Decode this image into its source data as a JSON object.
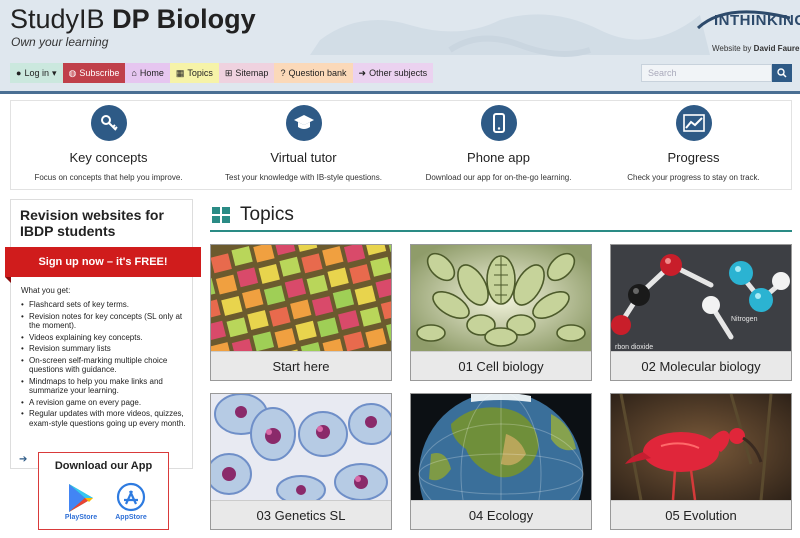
{
  "header": {
    "title_light": "StudyIB",
    "title_bold": "DP Biology",
    "tagline": "Own your learning",
    "logo_text": "INTHINKING",
    "byline_prefix": "Website by",
    "byline_author": "David Faure"
  },
  "nav": {
    "items": [
      {
        "label": "Log in",
        "icon": "user-icon",
        "color": "#cbe8de"
      },
      {
        "label": "Subscribe",
        "icon": "globe-icon",
        "color": "#c0404a"
      },
      {
        "label": "Home",
        "icon": "home-icon",
        "color": "#e6c6f0"
      },
      {
        "label": "Topics",
        "icon": "grid-icon",
        "color": "#f6f3a8"
      },
      {
        "label": "Sitemap",
        "icon": "sitemap-icon",
        "color": "#efd2df"
      },
      {
        "label": "Question bank",
        "icon": "question-icon",
        "color": "#fbd9b9"
      },
      {
        "label": "Other subjects",
        "icon": "arrow-circle-icon",
        "color": "#ebd2f0"
      }
    ],
    "search_placeholder": "Search"
  },
  "features": [
    {
      "title": "Key concepts",
      "desc": "Focus on concepts that help you improve.",
      "icon": "key-icon"
    },
    {
      "title": "Virtual tutor",
      "desc": "Test your knowledge with IB-style questions.",
      "icon": "graduation-cap-icon"
    },
    {
      "title": "Phone app",
      "desc": "Download our app for on-the-go learning.",
      "icon": "phone-icon"
    },
    {
      "title": "Progress",
      "desc": "Check your progress to stay on track.",
      "icon": "chart-line-icon"
    }
  ],
  "sidebar": {
    "heading": "Revision websites for IBDP students",
    "signup": "Sign up now – it's FREE!",
    "get_label": "What you get:",
    "benefits": [
      "Flashcard sets of key terms.",
      "Revision notes for key concepts (SL only at the moment).",
      "Videos explaining key concepts.",
      "Revision summary lists",
      "On-screen self-marking multiple choice questions with guidance.",
      "Mindmaps to help you make links and summarize your learning.",
      "A revision game on every page.",
      "Regular updates with more videos, quizzes, exam-style questions going up every month."
    ],
    "app_title": "Download our App",
    "playstore": "PlayStore",
    "appstore": "AppStore"
  },
  "topics": {
    "heading": "Topics",
    "cards": [
      {
        "label": "Start here",
        "image": "sticky-notes"
      },
      {
        "label": "01 Cell biology",
        "image": "diatoms"
      },
      {
        "label": "02 Molecular biology",
        "image": "molecule-model"
      },
      {
        "label": "03 Genetics SL",
        "image": "cells-micrograph"
      },
      {
        "label": "04 Ecology",
        "image": "globe"
      },
      {
        "label": "05 Evolution",
        "image": "scarlet-ibis"
      }
    ],
    "molecule_caption_1": "Nitrogen",
    "molecule_caption_2": "rbon dioxide"
  },
  "colors": {
    "accent": "#2e5a86",
    "teal": "#2a8b85",
    "signup_red": "#d01c1c"
  }
}
